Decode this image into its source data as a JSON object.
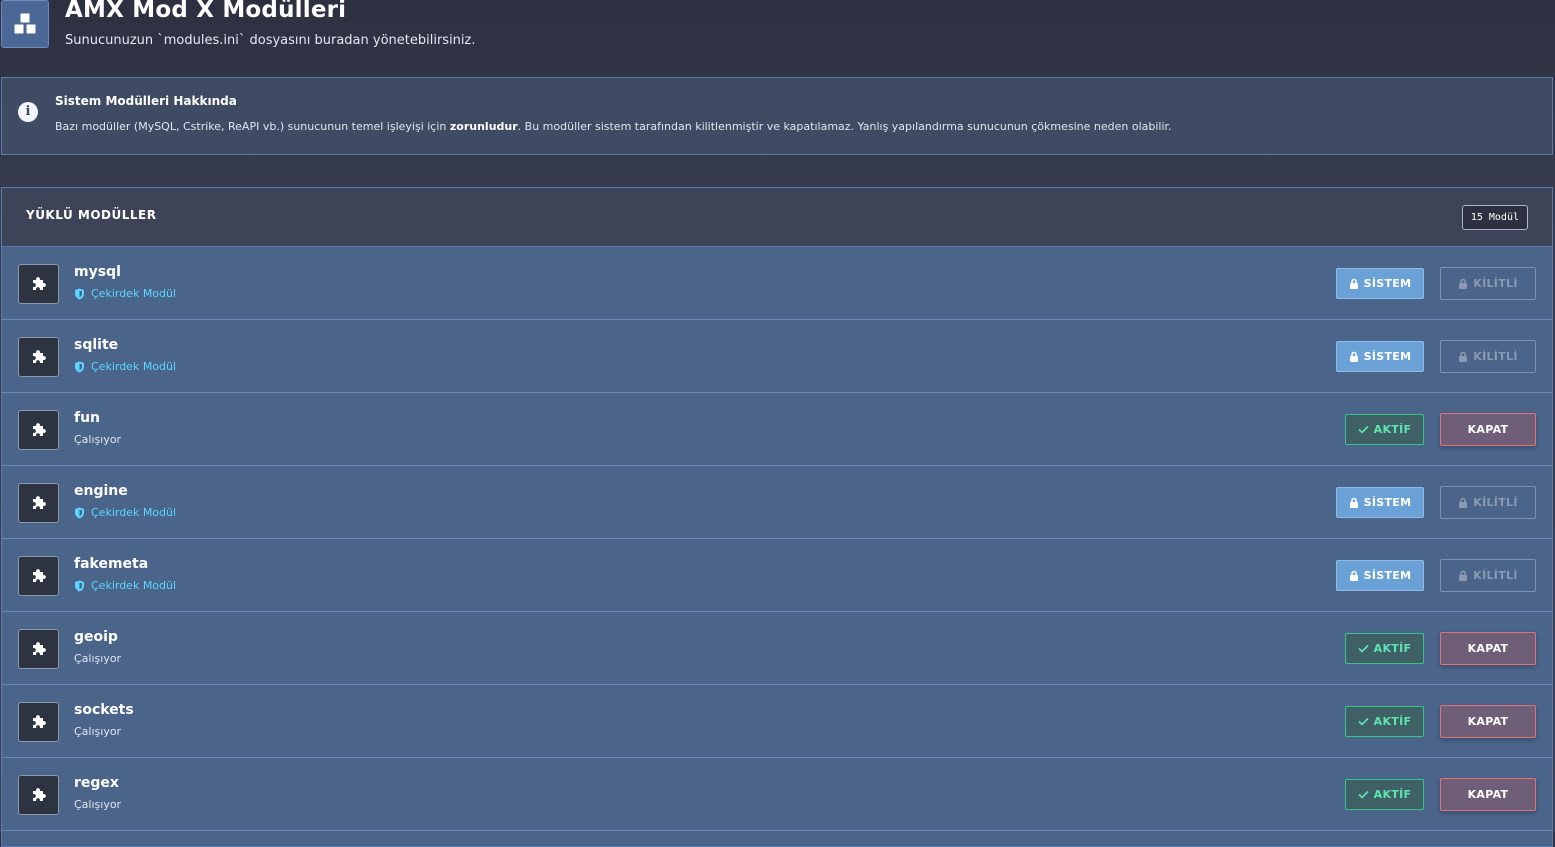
{
  "header": {
    "icon": "cubes-icon",
    "title": "AMX Mod X Modülleri",
    "subtitle": "Sunucunuzun `modules.ini` dosyasını buradan yönetebilirsiniz."
  },
  "info": {
    "icon": "info-icon",
    "title": "Sistem Modülleri Hakkında",
    "text_before": "Bazı modüller (MySQL, Cstrike, ReAPI vb.) sunucunun temel işleyişi için ",
    "text_bold": "zorunludur",
    "text_after": ". Bu modüller sistem tarafından kilitlenmiştir ve kapatılamaz. Yanlış yapılandırma sunucunun çökmesine neden olabilir."
  },
  "panel": {
    "title": "YÜKLÜ MODÜLLER",
    "count": "15 Modül"
  },
  "labels": {
    "system": "SİSTEM",
    "locked": "KİLİTLİ",
    "active": "AKTİF",
    "close": "KAPAT",
    "core": "Çekirdek Modül",
    "running": "Çalışıyor"
  },
  "colors": {
    "accent": "#6aa2d8",
    "active_green": "#35c48d",
    "close_red": "#e0707a",
    "core_cyan": "#5cd6ff"
  },
  "modules": [
    {
      "name": "mysql",
      "core": true,
      "sub": "Çekirdek Modül",
      "primary": "SİSTEM",
      "secondary": "KİLİTLİ"
    },
    {
      "name": "sqlite",
      "core": true,
      "sub": "Çekirdek Modül",
      "primary": "SİSTEM",
      "secondary": "KİLİTLİ"
    },
    {
      "name": "fun",
      "core": false,
      "sub": "Çalışıyor",
      "primary": "AKTİF",
      "secondary": "KAPAT"
    },
    {
      "name": "engine",
      "core": true,
      "sub": "Çekirdek Modül",
      "primary": "SİSTEM",
      "secondary": "KİLİTLİ"
    },
    {
      "name": "fakemeta",
      "core": true,
      "sub": "Çekirdek Modül",
      "primary": "SİSTEM",
      "secondary": "KİLİTLİ"
    },
    {
      "name": "geoip",
      "core": false,
      "sub": "Çalışıyor",
      "primary": "AKTİF",
      "secondary": "KAPAT"
    },
    {
      "name": "sockets",
      "core": false,
      "sub": "Çalışıyor",
      "primary": "AKTİF",
      "secondary": "KAPAT"
    },
    {
      "name": "regex",
      "core": false,
      "sub": "Çalışıyor",
      "primary": "AKTİF",
      "secondary": "KAPAT"
    }
  ]
}
